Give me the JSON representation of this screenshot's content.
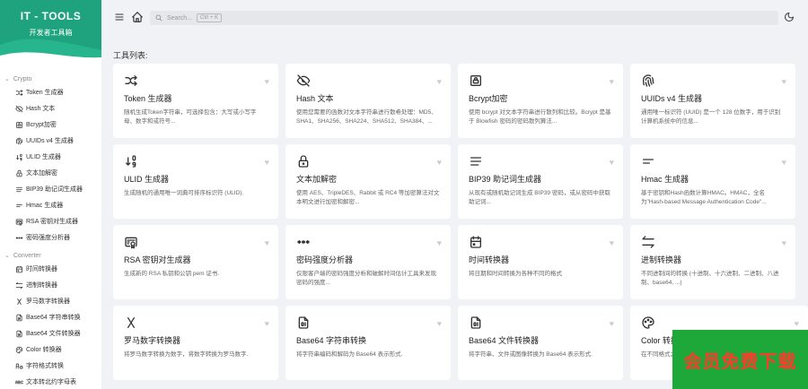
{
  "brand": {
    "title": "IT - TOOLS",
    "subtitle": "开发者工具箱",
    "color": "#1ea37e"
  },
  "sidebar": {
    "sections": [
      {
        "label": "Crypto",
        "items": [
          {
            "label": "Token 生成器",
            "icon": "shuffle-icon"
          },
          {
            "label": "Hash 文本",
            "icon": "eye-off-icon"
          },
          {
            "label": "Bcrypt加密",
            "icon": "lock-square-icon"
          },
          {
            "label": "UUIDs v4 生成器",
            "icon": "fingerprint-icon"
          },
          {
            "label": "ULID 生成器",
            "icon": "sort-numeric-icon"
          },
          {
            "label": "文本加解密",
            "icon": "lock-icon"
          },
          {
            "label": "BIP39 助记词生成器",
            "icon": "align-justified-icon"
          },
          {
            "label": "Hmac 生成器",
            "icon": "short-text-icon"
          },
          {
            "label": "RSA 密钥对生成器",
            "icon": "certificate-icon"
          },
          {
            "label": "密码强度分析器",
            "icon": "password-icon"
          }
        ]
      },
      {
        "label": "Converter",
        "items": [
          {
            "label": "时间转换器",
            "icon": "calendar-icon"
          },
          {
            "label": "进制转换器",
            "icon": "arrows-left-right-icon"
          },
          {
            "label": "罗马数字转换器",
            "icon": "letter-x-icon"
          },
          {
            "label": "Base64 字符串转换",
            "icon": "file-digit-icon"
          },
          {
            "label": "Base64 文件转换器",
            "icon": "file-digit-icon"
          },
          {
            "label": "Color 转换器",
            "icon": "palette-icon"
          },
          {
            "label": "字符格式转换",
            "icon": "letter-case-icon"
          },
          {
            "label": "文本转北约字母表",
            "icon": "alphabet-icon"
          }
        ]
      }
    ]
  },
  "header": {
    "search_placeholder": "Search...",
    "shortcut": "Ctrl + K"
  },
  "main": {
    "list_title": "工具列表:",
    "cards": [
      {
        "title": "Token 生成器",
        "desc": "随机生成Token字符串，可选择包含：大写或小写字母、数字和或符号...",
        "icon": "shuffle-icon"
      },
      {
        "title": "Hash 文本",
        "desc": "使用您需要的函数对文本字符串进行散希处理：MD5、SHA1、SHA256、SHA224、SHA512、SHA384、...",
        "icon": "eye-off-icon"
      },
      {
        "title": "Bcrypt加密",
        "desc": "使用 bcrypt 对文本字符串进行散列和比较。Bcrypt 是基于 Blowfish 密码的密码散列算法...",
        "icon": "lock-square-icon"
      },
      {
        "title": "UUIDs v4 生成器",
        "desc": "通用唯一标识符 (UUID) 是一个 128 位数字，用于识别计算机系统中的信息...",
        "icon": "fingerprint-icon"
      },
      {
        "title": "ULID 生成器",
        "desc": "生成随机的通用唯一词典可排序标识符 (ULID).",
        "icon": "sort-numeric-icon"
      },
      {
        "title": "文本加解密",
        "desc": "使用 AES、TripleDES、Rabbit 或 RC4 等加密算法对文本明文进行加密和解密...",
        "icon": "lock-icon"
      },
      {
        "title": "BIP39 助记词生成器",
        "desc": "从现有或随机助记词生成 BIP39 密码，或从密码中获取助记词...",
        "icon": "align-justified-icon"
      },
      {
        "title": "Hmac 生成器",
        "desc": "基于密钥和Hash函数计算HMAC。HMAC，全名为\"Hash-based Message Authentication Code\"...",
        "icon": "short-text-icon"
      },
      {
        "title": "RSA 密钥对生成器",
        "desc": "生成新的 RSA 私钥和公钥 pem 证书.",
        "icon": "certificate-icon"
      },
      {
        "title": "密码强度分析器",
        "desc": "仅限客户端的密码强度分析和破解时间估计工具来发现密码的强度...",
        "icon": "password-icon"
      },
      {
        "title": "时间转换器",
        "desc": "将日期和时间转换为各种不同的格式",
        "icon": "calendar-icon"
      },
      {
        "title": "进制转换器",
        "desc": "不同进制间的转换 (十进制、十六进制、二进制、八进制、base64, ...)",
        "icon": "arrows-left-right-icon"
      },
      {
        "title": "罗马数字转换器",
        "desc": "将罗马数字转换为数字，将数字转换为罗马数字.",
        "icon": "letter-x-icon"
      },
      {
        "title": "Base64 字符串转换",
        "desc": "将字符串编码和解码为 Base64 表示形式.",
        "icon": "file-digit-icon"
      },
      {
        "title": "Base64 文件转换器",
        "desc": "将字符串、文件或图像转换为 Base64 表示形式.",
        "icon": "file-digit-icon"
      },
      {
        "title": "Color 转换器",
        "desc": "在不同格式之间转换颜色 (hex, rgb, hsl and css name)",
        "icon": "palette-icon"
      }
    ]
  },
  "watermark": {
    "text": "会员免费下载",
    "bg": "#1ea83a",
    "color": "#ff3a2a"
  }
}
